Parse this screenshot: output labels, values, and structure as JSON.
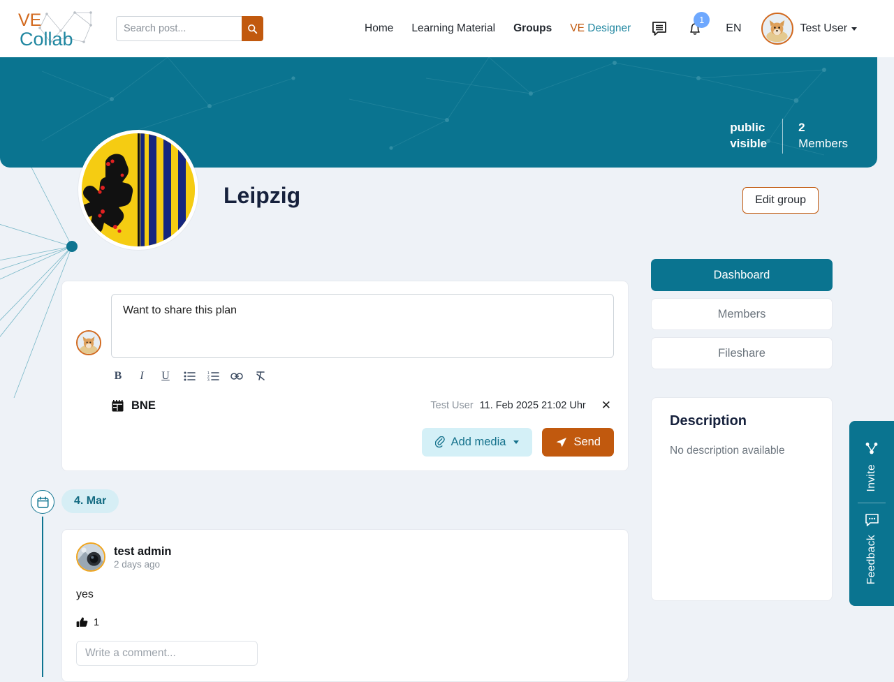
{
  "brand": {
    "name_part1": "VE",
    "name_part2": "Collab"
  },
  "search": {
    "placeholder": "Search post...",
    "value": "",
    "icon": "search-icon"
  },
  "nav": [
    {
      "label": "Home",
      "active": false,
      "style": "plain"
    },
    {
      "label": "Learning Material",
      "active": false,
      "style": "plain"
    },
    {
      "label": "Groups",
      "active": true,
      "style": "plain"
    },
    {
      "label": "VE Designer",
      "active": false,
      "style": "split",
      "part1": "VE",
      "part2": "Designer"
    }
  ],
  "header": {
    "messages_icon": "chat-bubble-icon",
    "notifications_icon": "bell-icon",
    "notifications_count": "1",
    "language": "EN",
    "user_name": "Test User"
  },
  "banner": {
    "visibility_line1": "public",
    "visibility_line2": "visible",
    "members_count": "2",
    "members_label": "Members"
  },
  "group": {
    "title": "Leipzig",
    "edit_button": "Edit group"
  },
  "composer": {
    "text": "Want to share this plan",
    "rte": [
      {
        "name": "bold-icon",
        "glyph": "B"
      },
      {
        "name": "italic-icon",
        "glyph": "I"
      },
      {
        "name": "underline-icon",
        "glyph": "U"
      },
      {
        "name": "bullet-list-icon",
        "glyph": ""
      },
      {
        "name": "numbered-list-icon",
        "glyph": ""
      },
      {
        "name": "link-icon",
        "glyph": ""
      },
      {
        "name": "clear-format-icon",
        "glyph": ""
      }
    ],
    "attachment": {
      "icon": "plan-document-icon",
      "name": "BNE",
      "author": "Test User",
      "date": "11. Feb 2025 21:02 Uhr",
      "remove": "✕"
    },
    "add_media_label": "Add media",
    "send_label": "Send"
  },
  "feed": {
    "date_chip": "4. Mar",
    "timeline_icon": "calendar-icon",
    "post": {
      "author": "test admin",
      "time": "2 days ago",
      "body": "yes",
      "like_icon": "thumbs-up-icon",
      "like_count": "1",
      "comment_placeholder": "Write a comment...",
      "comment_value": ""
    }
  },
  "sidebar": {
    "tabs": [
      {
        "label": "Dashboard",
        "active": true
      },
      {
        "label": "Members",
        "active": false
      },
      {
        "label": "Fileshare",
        "active": false
      }
    ],
    "description": {
      "title": "Description",
      "body": "No description available"
    }
  },
  "float_tabs": [
    {
      "label": "Invite",
      "icon": "share-network-icon"
    },
    {
      "label": "Feedback",
      "icon": "feedback-comment-icon"
    }
  ],
  "colors": {
    "brand_orange": "#c1590e",
    "brand_teal": "#1f86a0",
    "banner_teal": "#0a7490",
    "page_bg": "#eef2f7",
    "chip_bg": "#d6eef5",
    "badge_blue": "#6ea8fe"
  }
}
